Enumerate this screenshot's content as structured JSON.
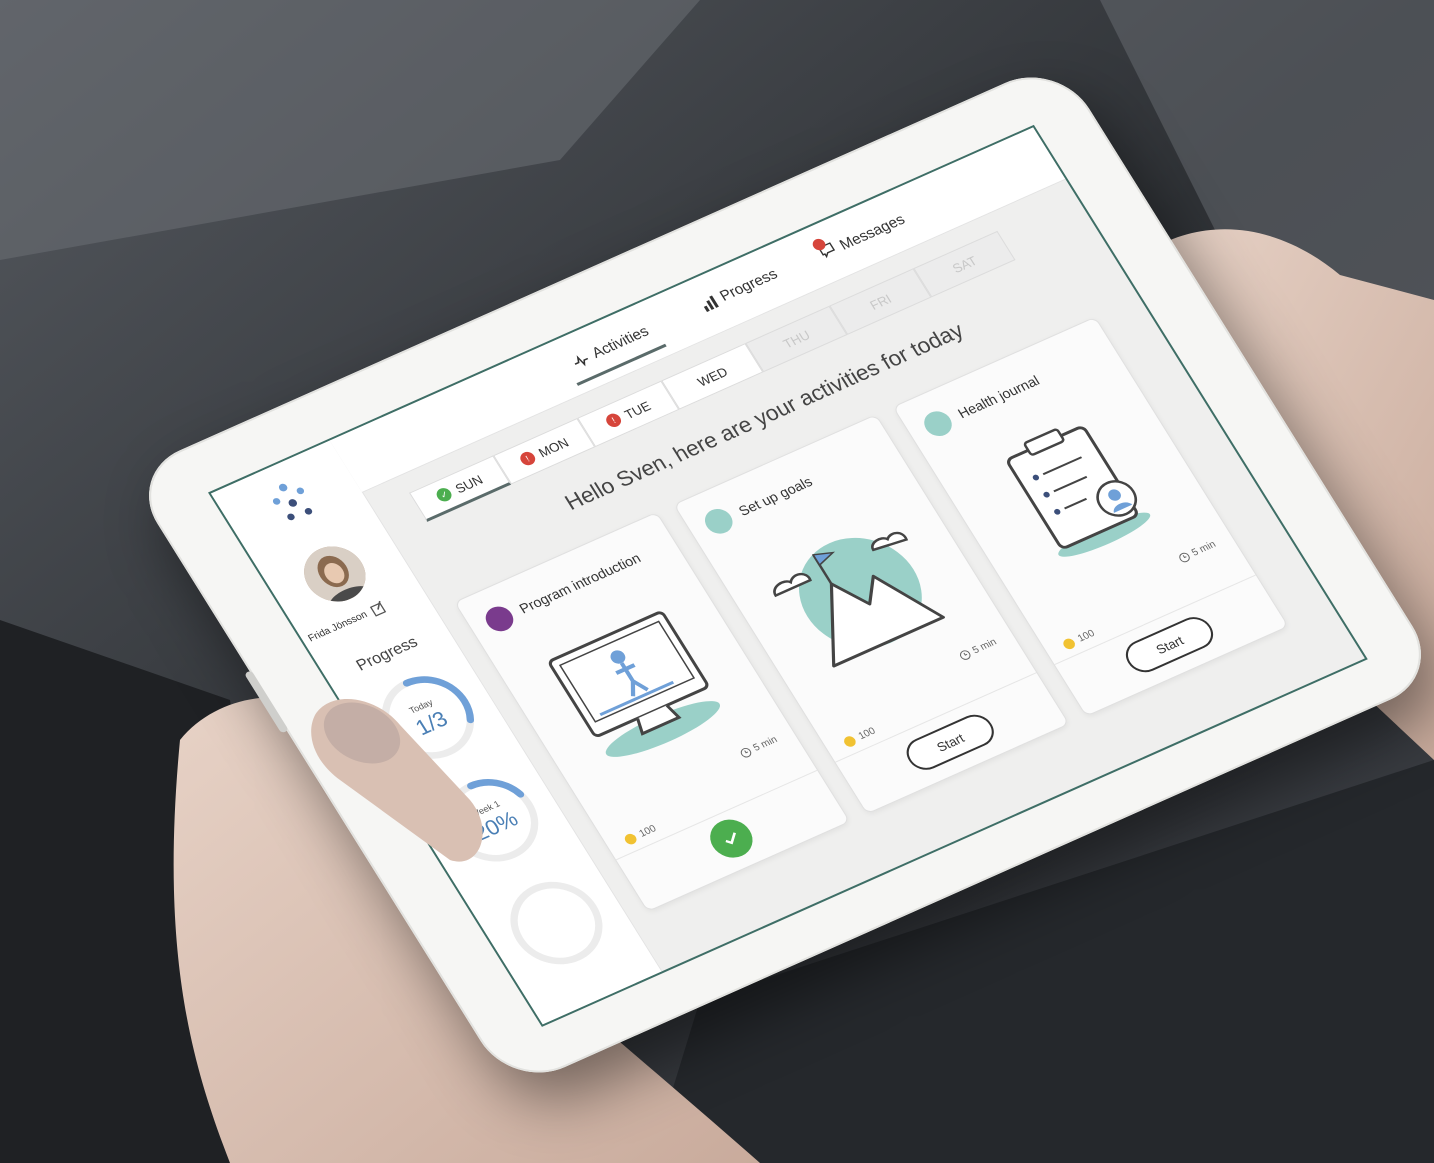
{
  "app": {
    "user_name": "Frida Jönsson"
  },
  "nav": {
    "tabs": [
      {
        "label": "Activities",
        "icon": "pulse-icon",
        "active": true
      },
      {
        "label": "Progress",
        "icon": "bar-chart-icon",
        "active": false
      },
      {
        "label": "Messages",
        "icon": "chat-icon",
        "active": false
      }
    ]
  },
  "sidebar": {
    "progress_title": "Progress",
    "today": {
      "label": "Today",
      "value": "1/3",
      "fraction": 0.33
    },
    "week": {
      "label": "Week 1",
      "value": "20%",
      "fraction": 0.2
    }
  },
  "days": [
    {
      "label": "SUN",
      "status": "done"
    },
    {
      "label": "MON",
      "status": "missed"
    },
    {
      "label": "TUE",
      "status": "missed"
    },
    {
      "label": "WED",
      "status": "normal"
    },
    {
      "label": "THU",
      "status": "disabled"
    },
    {
      "label": "FRI",
      "status": "disabled"
    },
    {
      "label": "SAT",
      "status": "disabled"
    }
  ],
  "greeting": "Hello Sven, here are your activities for today",
  "cards": [
    {
      "title": "Program introduction",
      "duration": "5 min",
      "points": "100",
      "action": "done",
      "accent": "#7a3b8d"
    },
    {
      "title": "Set up goals",
      "duration": "5 min",
      "points": "100",
      "action": "Start",
      "accent": "#9ad0c8"
    },
    {
      "title": "Health journal",
      "duration": "5 min",
      "points": "100",
      "action": "Start",
      "accent": "#9ad0c8"
    }
  ],
  "colors": {
    "accent_green": "#4cae4f",
    "accent_red": "#d6453b",
    "ring_blue": "#6fa0d8",
    "teal_illustration": "#9ad0c8",
    "screen_border": "#3e6e66"
  }
}
